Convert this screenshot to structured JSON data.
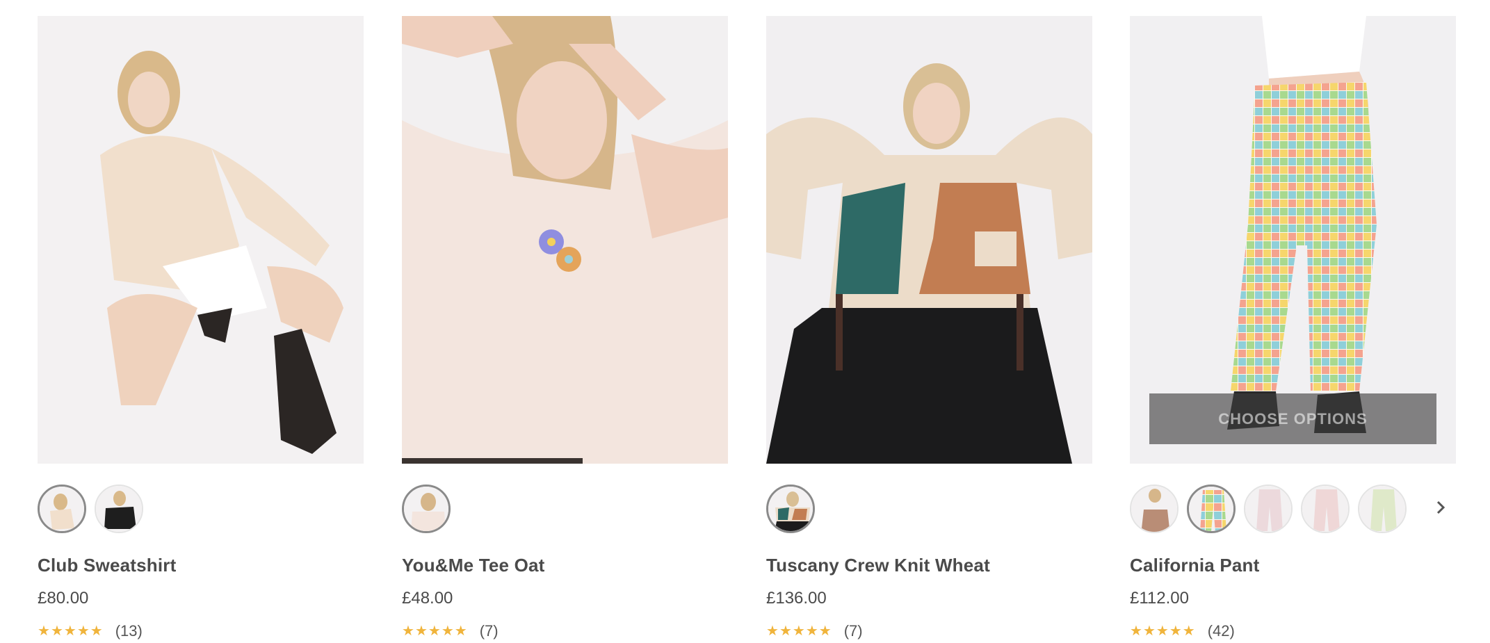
{
  "colors": {
    "star": "#f0b43c",
    "text": "#4a4a4a",
    "overlay": "#3c3c3c"
  },
  "products": [
    {
      "title": "Club Sweatshirt",
      "price": "£80.00",
      "rating": 5,
      "reviews": "(13)",
      "image": "model-crouching-cream-sweatshirt",
      "swatch_count": 2,
      "selected_swatch": 0
    },
    {
      "title": "You&Me Tee Oat",
      "price": "£48.00",
      "rating": 5,
      "reviews": "(7)",
      "image": "model-oat-tee-flower-print",
      "swatch_count": 1,
      "selected_swatch": 0
    },
    {
      "title": "Tuscany Crew Knit Wheat",
      "price": "£136.00",
      "rating": 5,
      "reviews": "(7)",
      "image": "model-seated-patterned-knit",
      "swatch_count": 1,
      "selected_swatch": 0
    },
    {
      "title": "California Pant",
      "price": "£112.00",
      "rating": 5,
      "reviews": "(42)",
      "image": "model-printed-pants-sandals",
      "choose_options": "CHOOSE OPTIONS",
      "swatch_count": 5,
      "selected_swatch": 1,
      "next_icon": "chevron-right-icon"
    }
  ]
}
